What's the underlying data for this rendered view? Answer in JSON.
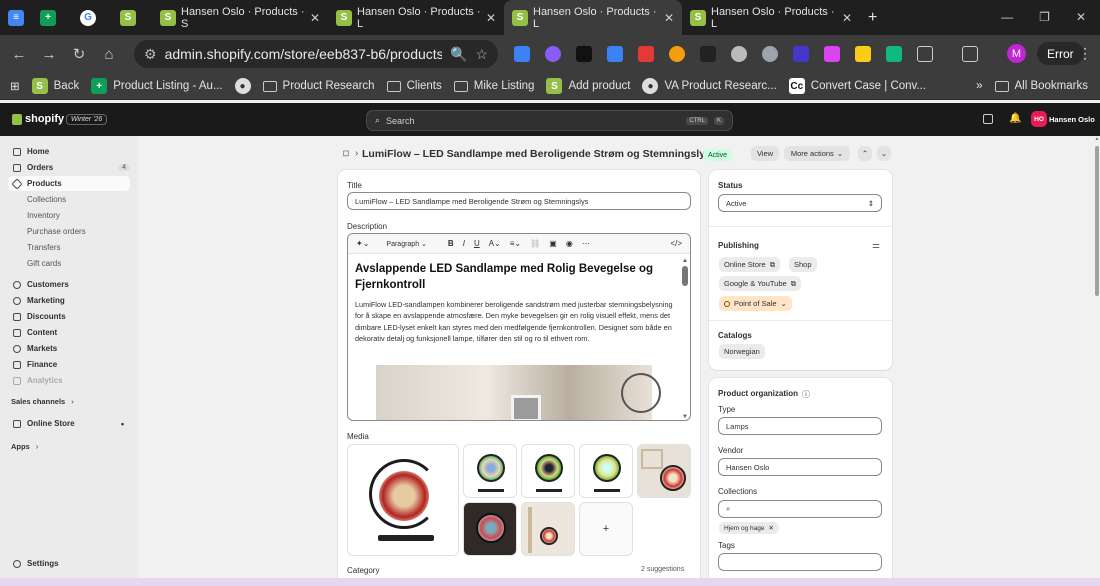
{
  "browser": {
    "tabs": [
      {
        "label": "",
        "favicon_color": "#4285f4",
        "favicon": "docs-icon"
      },
      {
        "label": "",
        "favicon_color": "#0f9d58",
        "favicon": "sheets-icon"
      },
      {
        "label": "",
        "favicon_color": "#ffffff",
        "favicon": "google-icon"
      },
      {
        "label": "",
        "favicon_color": "#95bf47",
        "favicon": "shopify-icon"
      },
      {
        "label": "Hansen Oslo · Products · S",
        "favicon_color": "#95bf47",
        "favicon": "shopify-icon"
      },
      {
        "label": "Hansen Oslo · Products · L",
        "favicon_color": "#95bf47",
        "favicon": "shopify-icon"
      },
      {
        "label": "Hansen Oslo · Products · L",
        "favicon_color": "#95bf47",
        "favicon": "shopify-icon",
        "active": true
      },
      {
        "label": "Hansen Oslo · Products · L",
        "favicon_color": "#95bf47",
        "favicon": "shopify-icon"
      }
    ],
    "new_tab": "+",
    "url": "admin.shopify.com/store/eeb837-b6/products/1...",
    "profile_initial": "M",
    "error_label": "Error",
    "bookmarks": [
      {
        "label": "Back",
        "icon": "shopify-icon"
      },
      {
        "label": "Product Listing - Au...",
        "icon": "sheets-icon"
      },
      {
        "label": "",
        "icon": "globe-icon"
      },
      {
        "label": "Product Research",
        "icon": "folder-icon"
      },
      {
        "label": "Clients",
        "icon": "folder-icon"
      },
      {
        "label": "Mike Listing",
        "icon": "folder-icon"
      },
      {
        "label": "Add product",
        "icon": "shopify-icon"
      },
      {
        "label": "VA Product Researc...",
        "icon": "globe-icon"
      },
      {
        "label": "Convert Case | Conv...",
        "icon": "cc-icon"
      }
    ],
    "more_bookmarks": "»",
    "all_bookmarks": "All Bookmarks"
  },
  "shopify": {
    "logo": "shopify",
    "badge": "Winter '26",
    "search_placeholder": "Search",
    "kbd1": "CTRL",
    "kbd2": "K",
    "store_initials": "HO",
    "store_name": "Hansen Oslo"
  },
  "sidebar": {
    "items": [
      {
        "label": "Home",
        "icon": "home-icon"
      },
      {
        "label": "Orders",
        "icon": "orders-icon",
        "badge": "4"
      },
      {
        "label": "Products",
        "icon": "tag-icon",
        "selected": true
      },
      {
        "label": "Collections",
        "sub": true
      },
      {
        "label": "Inventory",
        "sub": true
      },
      {
        "label": "Purchase orders",
        "sub": true
      },
      {
        "label": "Transfers",
        "sub": true
      },
      {
        "label": "Gift cards",
        "sub": true
      },
      {
        "label": "Customers",
        "icon": "person-icon"
      },
      {
        "label": "Marketing",
        "icon": "target-icon"
      },
      {
        "label": "Discounts",
        "icon": "discount-icon"
      },
      {
        "label": "Content",
        "icon": "content-icon"
      },
      {
        "label": "Markets",
        "icon": "globe-icon"
      },
      {
        "label": "Finance",
        "icon": "finance-icon"
      },
      {
        "label": "Analytics",
        "icon": "chart-icon"
      }
    ],
    "sales_channels": "Sales channels",
    "online_store": "Online Store",
    "apps": "Apps",
    "settings": "Settings"
  },
  "product": {
    "title": "LumiFlow – LED Sandlampe med Beroligende Strøm og Stemningslys",
    "status_badge": "Active",
    "view_btn": "View",
    "more_actions": "More actions",
    "title_label": "Title",
    "title_value": "LumiFlow – LED Sandlampe med Beroligende Strøm og Stemningslys",
    "description_label": "Description",
    "paragraph": "Paragraph",
    "desc_heading": "Avslappende LED Sandlampe med Rolig Bevegelse og Fjernkontroll",
    "desc_body": "LumiFlow LED-sandlampen kombinerer beroligende sandstrøm med justerbar stemningsbelysning for å skape en avslappende atmosfære. Den myke bevegelsen gir en rolig visuell effekt, mens det dimbare LED-lyset enkelt kan styres med den medfølgende fjernkontrollen. Designet som både en dekorativ detalj og funksjonell lampe, tilfører den stil og ro til ethvert rom.",
    "media_label": "Media",
    "add_media": "+",
    "category_label": "Category",
    "suggestions": "2 suggestions"
  },
  "right": {
    "status_label": "Status",
    "status_value": "Active",
    "publishing_label": "Publishing",
    "channels": [
      "Online Store",
      "Shop",
      "Google & YouTube",
      "Point of Sale"
    ],
    "catalogs_label": "Catalogs",
    "catalog_value": "Norwegian",
    "org_label": "Product organization",
    "type_label": "Type",
    "type_value": "Lamps",
    "vendor_label": "Vendor",
    "vendor_value": "Hansen Oslo",
    "collections_label": "Collections",
    "collection_chip": "Hjem og hage",
    "tags_label": "Tags"
  },
  "colors": {
    "accent": "#303030",
    "active_badge": "#cdfee1",
    "point_of_sale": "#ffe4c6",
    "store_avatar": "#e51c59"
  }
}
